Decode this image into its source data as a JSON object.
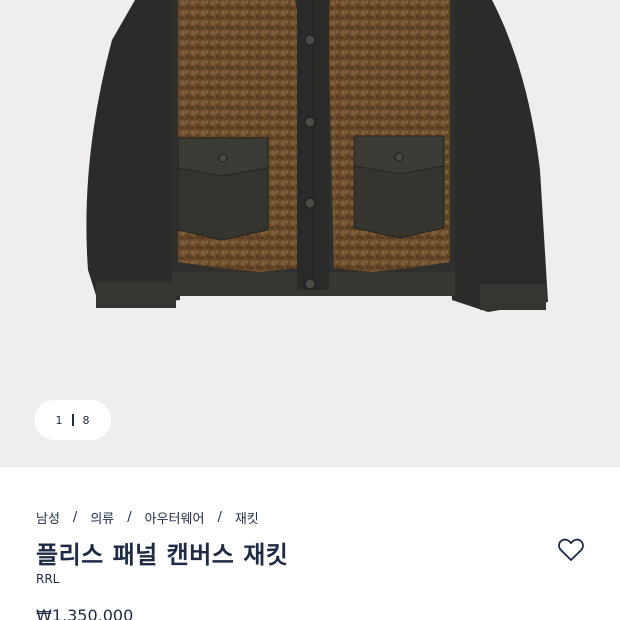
{
  "product_image": {
    "icon": "jacket-product-photo",
    "colors": {
      "background": "#efeeec",
      "canvas": "#2a2a28",
      "sherpa": "#6b4a2a"
    }
  },
  "pager": {
    "current": "1",
    "total": "8"
  },
  "breadcrumb": [
    {
      "label": "남성"
    },
    {
      "label": "의류"
    },
    {
      "label": "아우터웨어"
    },
    {
      "label": "재킷"
    }
  ],
  "breadcrumb_separator": "/",
  "product": {
    "title": "플리스 패널 캔버스 재킷",
    "brand": "RRL",
    "price": "₩1,350,000"
  },
  "wishlist": {
    "icon": "heart-icon"
  }
}
